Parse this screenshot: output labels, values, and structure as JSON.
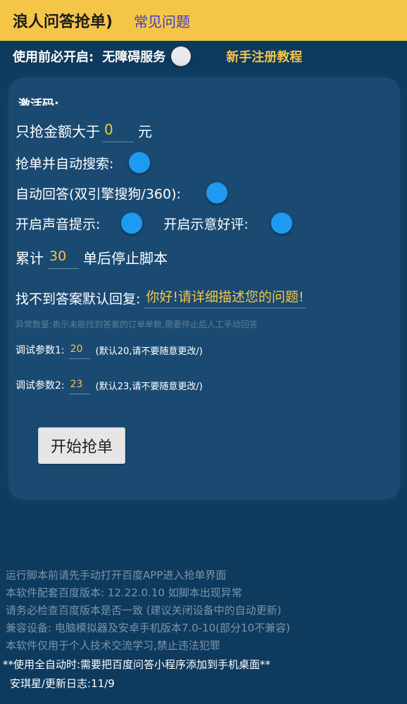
{
  "header": {
    "app_title": "浪人问答抢单)",
    "faq_link": "常见问题"
  },
  "accessibility": {
    "label": "使用前必开启:",
    "service": "无障碍服务",
    "tutorial_link": "新手注册教程"
  },
  "card": {
    "activation_label": "激活码:",
    "min_amount": {
      "prefix": "只抢金额大于",
      "value": "0",
      "unit": "元"
    },
    "auto_search": {
      "label": "抢单并自动搜索:"
    },
    "auto_answer": {
      "label": "自动回答(双引擎搜狗/360):"
    },
    "sound_prompt": {
      "label": "开启声音提示:"
    },
    "good_review": {
      "label": "开启示意好评:"
    },
    "stop_after": {
      "prefix": "累计",
      "value": "30",
      "suffix": "单后停止脚本"
    },
    "default_reply": {
      "label": "找不到答案默认回复:",
      "value": "你好!请详细描述您的问题!"
    },
    "anomaly_note": "异常数量:表示未能找到答案的订单单数,需要停止后人工手动回答",
    "debug1": {
      "label": "调试参数1:",
      "value": "20",
      "note": "(默认20,请不要随意更改/)"
    },
    "debug2": {
      "label": "调试参数2:",
      "value": "23",
      "note": "(默认23,请不要随意更改/)"
    },
    "start_button": "开始抢单"
  },
  "footer": {
    "lines": [
      "运行脚本前请先手动打开百度APP进入抢单界面",
      "本软件配套百度版本: 12.22.0.10  如脚本出现异常",
      "请务必检查百度版本是否一致 (建议关闭设备中的自动更新)",
      "兼容设备: 电脑模拟器及安卓手机版本7.0-10(部分10不兼容)",
      "本软件仅用于个人技术交流学习,禁止违法犯罪"
    ],
    "notice": "**使用全自动时:需要把百度问答小程序添加到手机桌面**",
    "changelog": "安琪星/更新日志:11/9"
  },
  "colors": {
    "header_bg": "#f5c548",
    "page_bg": "#0e3a5e",
    "accent_gold": "#f3c64a",
    "toggle_blue": "#1e9bf0",
    "faq_link": "#3b3bd0"
  }
}
